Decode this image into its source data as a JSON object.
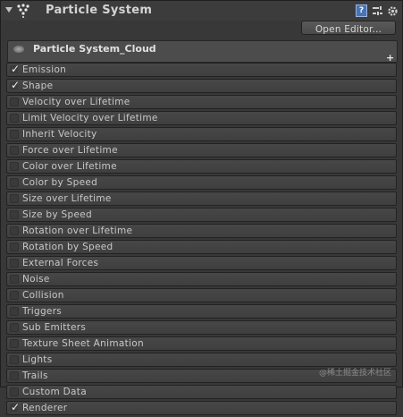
{
  "header": {
    "title": "Particle System",
    "icons": [
      "foldout-arrow-icon",
      "particle-system-icon",
      "help-icon",
      "preset-icon",
      "gear-icon"
    ],
    "help_label": "?"
  },
  "toolbar": {
    "open_editor_label": "Open Editor..."
  },
  "system": {
    "name": "Particle System_Cloud",
    "add_label": "+"
  },
  "modules": [
    {
      "label": "Emission",
      "checked": true
    },
    {
      "label": "Shape",
      "checked": true
    },
    {
      "label": "Velocity over Lifetime",
      "checked": false
    },
    {
      "label": "Limit Velocity over Lifetime",
      "checked": false
    },
    {
      "label": "Inherit Velocity",
      "checked": false
    },
    {
      "label": "Force over Lifetime",
      "checked": false
    },
    {
      "label": "Color over Lifetime",
      "checked": false
    },
    {
      "label": "Color by Speed",
      "checked": false
    },
    {
      "label": "Size over Lifetime",
      "checked": false
    },
    {
      "label": "Size by Speed",
      "checked": false
    },
    {
      "label": "Rotation over Lifetime",
      "checked": false
    },
    {
      "label": "Rotation by Speed",
      "checked": false
    },
    {
      "label": "External Forces",
      "checked": false
    },
    {
      "label": "Noise",
      "checked": false
    },
    {
      "label": "Collision",
      "checked": false
    },
    {
      "label": "Triggers",
      "checked": false
    },
    {
      "label": "Sub Emitters",
      "checked": false
    },
    {
      "label": "Texture Sheet Animation",
      "checked": false
    },
    {
      "label": "Lights",
      "checked": false
    },
    {
      "label": "Trails",
      "checked": false
    },
    {
      "label": "Custom Data",
      "checked": false
    },
    {
      "label": "Renderer",
      "checked": true
    }
  ],
  "watermark": "@稀土掘金技术社区",
  "colors": {
    "background": "#383838",
    "module": "#444444",
    "text": "#c8c8c8"
  }
}
